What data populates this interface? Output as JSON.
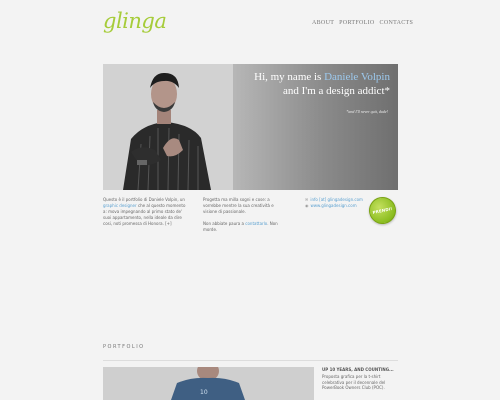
{
  "logo": {
    "text": "glinga",
    "color": "#a6cc3a"
  },
  "nav": {
    "items": [
      "ABOUT",
      "PORTFOLIO",
      "CONTACTS"
    ]
  },
  "hero": {
    "line1_prefix": "Hi, my name is ",
    "line1_name": "Daniele Volpin",
    "line2": "and I'm a design addict*",
    "note": "*and I'll never quit, dude!"
  },
  "about": {
    "col1": {
      "text_before": "Questo è il portfolio di Daniele Volpin, un ",
      "link": "graphic designer",
      "text_after": " che al questo momento a: mova impegnando al primo stato de' suoi appartamento, nella ideale da dire cosi, noti promessa di Honora. [+]"
    },
    "col2": {
      "p1": "Progetta ma milla sogni e cose: a vorrebbe mentre la sua creatività e visione di passionale.",
      "p2_before": "Non abbiate paura a ",
      "p2_link": "contattarlo",
      "p2_after": ". Non morde."
    },
    "contacts": {
      "email": "info [at] glingadesign.com",
      "web": "www.glingadesign.com"
    },
    "badge": "PRENDI!"
  },
  "portfolio": {
    "title": "PORTFOLIO",
    "item": {
      "title": "UP 10 YEARS, AND COUNTING...",
      "description": "Proposta grafica per la t-shirt celebrativa per il decennale del PowerBook Owners Club (POC)."
    }
  }
}
